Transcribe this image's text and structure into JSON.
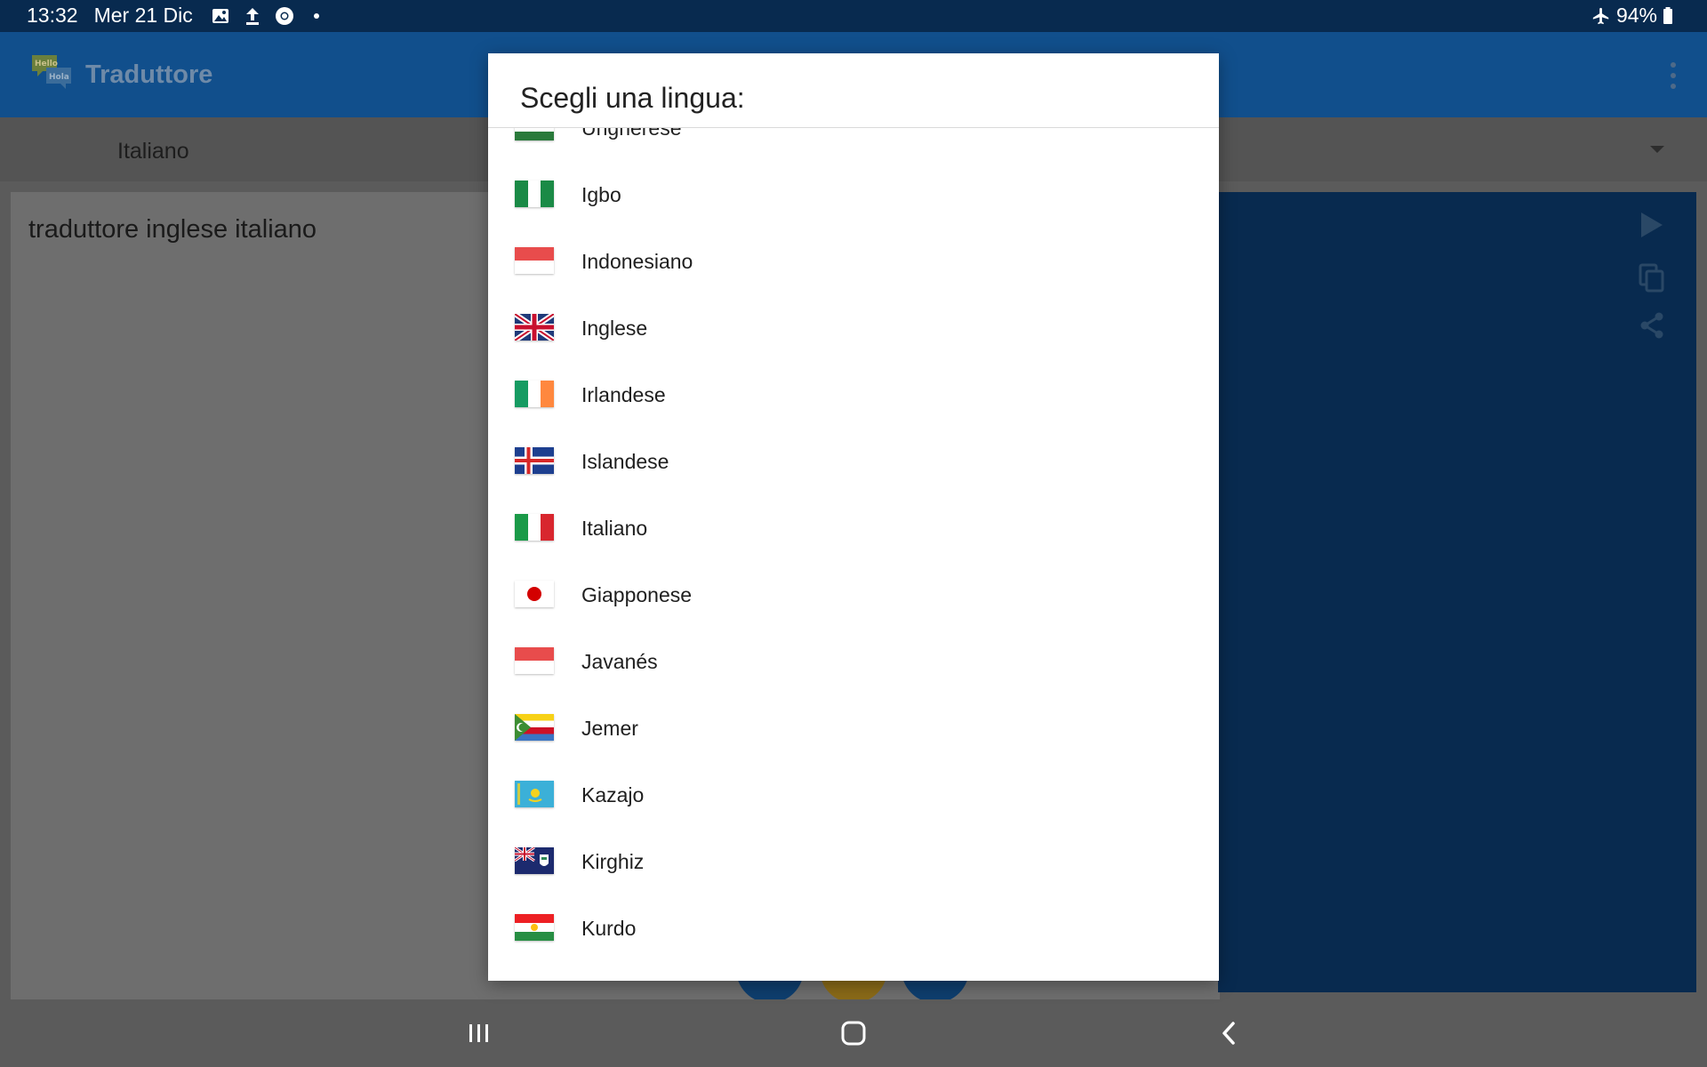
{
  "status_bar": {
    "time": "13:32",
    "date": "Mer 21 Dic",
    "left_icons": [
      "image-icon",
      "upload-icon",
      "chrome-icon",
      "dot-icon"
    ],
    "right_icons": [
      "airplane-icon",
      "battery-icon"
    ],
    "battery": "94%"
  },
  "app_bar": {
    "logo_icon": "hello-hola-logo-icon",
    "logo_text_1": "Hello",
    "logo_text_2": "Hola",
    "title": "Traduttore",
    "menu_icon": "overflow-menu-icon"
  },
  "language_bar": {
    "source_language": "Italiano",
    "dropdown_icon": "caret-down-icon"
  },
  "input": {
    "text": "traduttore inglese italiano"
  },
  "output": {
    "icons": [
      "play-icon",
      "copy-icon",
      "share-icon"
    ]
  },
  "dialog": {
    "title": "Scegli una lingua:",
    "languages": [
      {
        "label": "Ungherese",
        "flag": "hungary-flag-icon"
      },
      {
        "label": "Igbo",
        "flag": "nigeria-flag-icon"
      },
      {
        "label": "Indonesiano",
        "flag": "indonesia-flag-icon"
      },
      {
        "label": "Inglese",
        "flag": "uk-flag-icon"
      },
      {
        "label": "Irlandese",
        "flag": "ireland-flag-icon"
      },
      {
        "label": "Islandese",
        "flag": "iceland-flag-icon"
      },
      {
        "label": "Italiano",
        "flag": "italy-flag-icon"
      },
      {
        "label": "Giapponese",
        "flag": "japan-flag-icon"
      },
      {
        "label": "Javanés",
        "flag": "indonesia-flag-icon"
      },
      {
        "label": "Jemer",
        "flag": "comoros-flag-icon"
      },
      {
        "label": "Kazajo",
        "flag": "kazakhstan-flag-icon"
      },
      {
        "label": "Kirghiz",
        "flag": "cayman-islands-flag-icon"
      },
      {
        "label": "Kurdo",
        "flag": "kurdistan-flag-icon"
      }
    ]
  },
  "nav_bar": {
    "icons": [
      "recent-apps-icon",
      "home-icon",
      "back-icon"
    ]
  },
  "colors": {
    "status_bar": "#082a4f",
    "app_bar": "#114f8c",
    "output_panel": "#082a4f",
    "dialog_bg": "#ffffff"
  }
}
